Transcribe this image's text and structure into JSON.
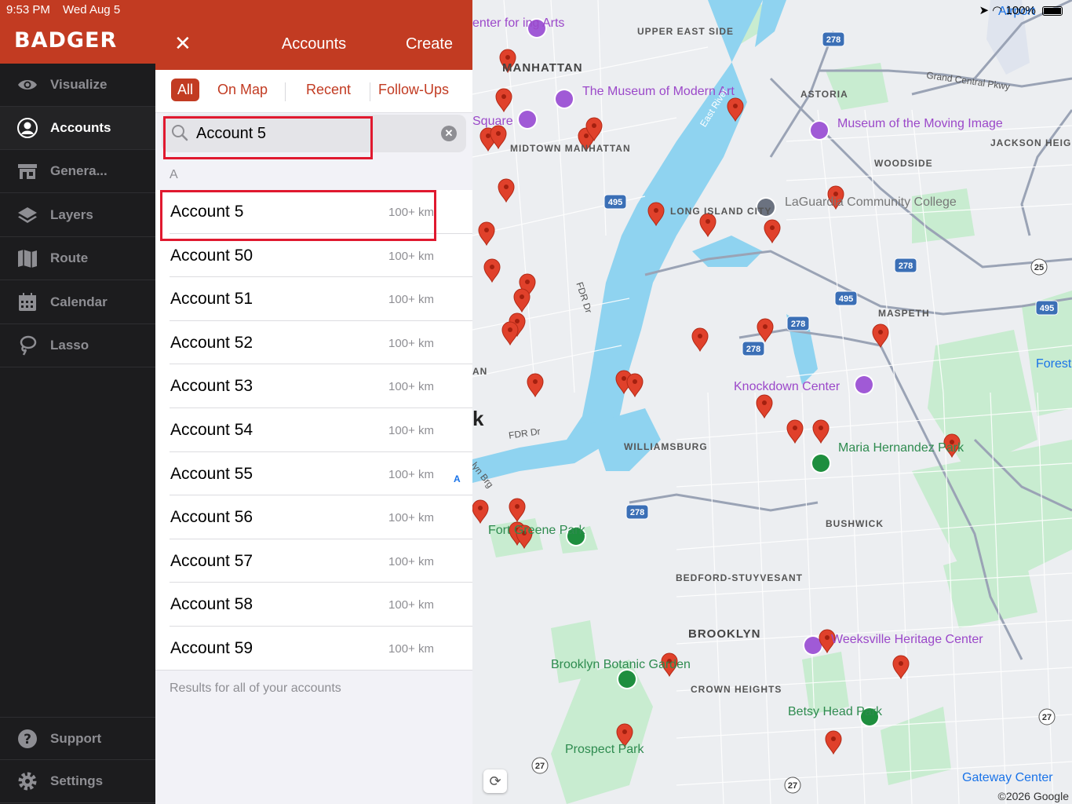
{
  "status_bar": {
    "time": "9:53 PM",
    "date": "Wed Aug 5",
    "battery": "100%"
  },
  "app": {
    "brand": "BADGER"
  },
  "sidebar": {
    "items": [
      {
        "label": "Visualize",
        "icon": "eye-icon"
      },
      {
        "label": "Accounts",
        "icon": "person-circle-icon"
      },
      {
        "label": "Genera...",
        "icon": "store-icon"
      },
      {
        "label": "Layers",
        "icon": "layers-icon"
      },
      {
        "label": "Route",
        "icon": "map-route-icon"
      },
      {
        "label": "Calendar",
        "icon": "calendar-icon"
      },
      {
        "label": "Lasso",
        "icon": "lasso-icon"
      }
    ],
    "footer": [
      {
        "label": "Support",
        "icon": "help-icon"
      },
      {
        "label": "Settings",
        "icon": "gear-icon"
      }
    ]
  },
  "panel": {
    "title": "Accounts",
    "create_label": "Create",
    "close_label": "✕",
    "tabs": [
      "All",
      "On Map",
      "Recent",
      "Follow-Ups"
    ],
    "search_value": "Account 5",
    "section_letter": "A",
    "index_letter": "A",
    "accounts": [
      {
        "name": "Account 5",
        "distance": "100+ km"
      },
      {
        "name": "Account 50",
        "distance": "100+ km"
      },
      {
        "name": "Account 51",
        "distance": "100+ km"
      },
      {
        "name": "Account 52",
        "distance": "100+ km"
      },
      {
        "name": "Account 53",
        "distance": "100+ km"
      },
      {
        "name": "Account 54",
        "distance": "100+ km"
      },
      {
        "name": "Account 55",
        "distance": "100+ km"
      },
      {
        "name": "Account 56",
        "distance": "100+ km"
      },
      {
        "name": "Account 57",
        "distance": "100+ km"
      },
      {
        "name": "Account 58",
        "distance": "100+ km"
      },
      {
        "name": "Account 59",
        "distance": "100+ km"
      }
    ],
    "footer_text": "Results for all of your accounts"
  },
  "map": {
    "neighborhoods": [
      "UPPER EAST SIDE",
      "MANHATTAN",
      "MIDTOWN MANHATTAN",
      "ASTORIA",
      "WOODSIDE",
      "JACKSON HEIGHTS",
      "LONG ISLAND CITY",
      "MASPETH",
      "WILLIAMSBURG",
      "BUSHWICK",
      "BEDFORD-STUYVESANT",
      "BROOKLYN",
      "CROWN HEIGHTS"
    ],
    "pois": [
      "The Museum of Modern Art",
      "Museum of the Moving Image",
      "LaGuardia Community College",
      "Knockdown Center",
      "Weeksville Heritage Center",
      "enter for ing Arts",
      "Square"
    ],
    "parks": [
      "Maria Hernandez Park",
      "Fort Greene Park",
      "Brooklyn Botanic Garden",
      "Betsy Head Park",
      "Prospect Park"
    ],
    "roads": [
      "Grand Central Pkwy",
      "East River",
      "FDR Dr",
      "FDR Dr",
      "lyn Brg"
    ],
    "highway_shields": [
      "278",
      "495",
      "278",
      "495",
      "278",
      "278",
      "495",
      "278",
      "25",
      "27",
      "27",
      "27"
    ],
    "other_labels": [
      "Forest",
      "Gateway Center",
      "Airport",
      "AN",
      "k"
    ],
    "copyright": "©2026 Google",
    "pin_color": "#e0412b",
    "water_color": "#8fd3f0",
    "park_color": "#c8ecd0"
  }
}
